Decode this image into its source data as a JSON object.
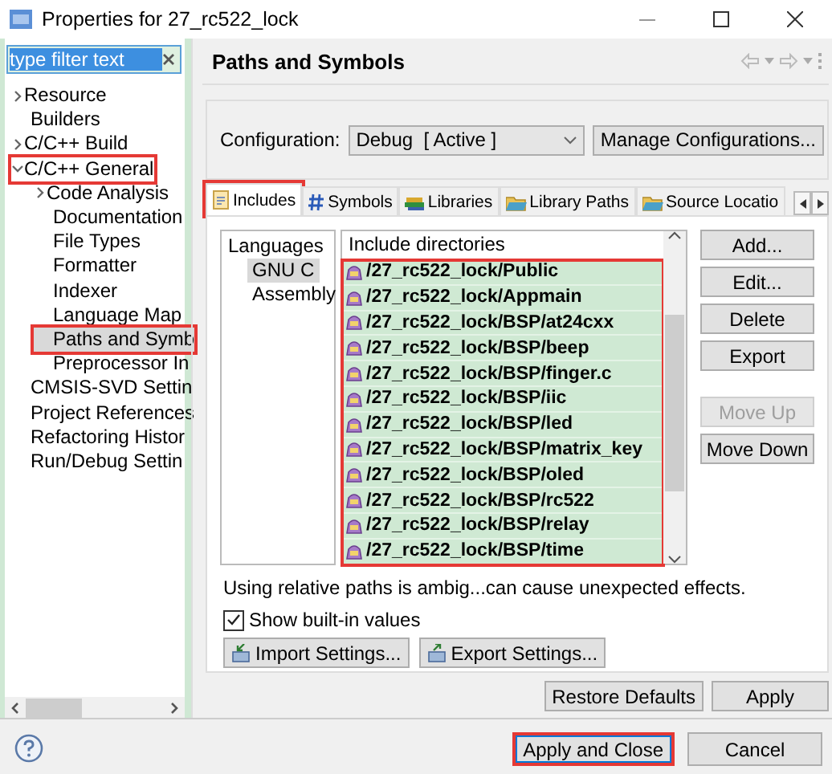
{
  "window": {
    "title": "Properties for 27_rc522_lock"
  },
  "sidebar": {
    "filter": {
      "value": "type filter text"
    },
    "tree": [
      {
        "label": "Resource",
        "expanded": false,
        "selected": false,
        "highlighted": false
      },
      {
        "label": "Builders",
        "selected": false,
        "highlighted": false
      },
      {
        "label": "C/C++ Build",
        "expanded": false,
        "selected": false,
        "highlighted": false
      },
      {
        "label": "C/C++ General",
        "expanded": true,
        "selected": false,
        "highlighted": true,
        "children": [
          {
            "label": "Code Analysis",
            "expanded": false,
            "selected": false,
            "highlighted": false
          },
          {
            "label": "Documentation",
            "selected": false,
            "highlighted": false
          },
          {
            "label": "File Types",
            "selected": false,
            "highlighted": false
          },
          {
            "label": "Formatter",
            "selected": false,
            "highlighted": false
          },
          {
            "label": "Indexer",
            "selected": false,
            "highlighted": false
          },
          {
            "label": "Language Map",
            "selected": false,
            "highlighted": false
          },
          {
            "label": "Paths and Symb",
            "selected": true,
            "highlighted": true
          },
          {
            "label": "Preprocessor In",
            "selected": false,
            "highlighted": false
          }
        ]
      },
      {
        "label": "CMSIS-SVD Settin",
        "selected": false,
        "highlighted": false
      },
      {
        "label": "Project References",
        "selected": false,
        "highlighted": false
      },
      {
        "label": "Refactoring Histor",
        "selected": false,
        "highlighted": false
      },
      {
        "label": "Run/Debug Settin",
        "selected": false,
        "highlighted": false
      }
    ]
  },
  "page": {
    "title": "Paths and Symbols"
  },
  "configuration": {
    "label": "Configuration:",
    "value": "Debug  [ Active ]",
    "button": "Manage Configurations..."
  },
  "tabs": [
    {
      "label": "Includes",
      "kind": "document",
      "selected": true,
      "highlighted": true
    },
    {
      "label": "Symbols",
      "kind": "hash",
      "selected": false,
      "highlighted": false
    },
    {
      "label": "Libraries",
      "kind": "books",
      "selected": false,
      "highlighted": false
    },
    {
      "label": "Library Paths",
      "kind": "folder",
      "selected": false,
      "highlighted": false
    },
    {
      "label": "Source Locatio",
      "kind": "folder",
      "selected": false,
      "highlighted": false
    }
  ],
  "languages": {
    "title": "Languages",
    "items": [
      {
        "label": "GNU C",
        "selected": true
      },
      {
        "label": "Assembly",
        "selected": false
      }
    ]
  },
  "include_table": {
    "column": "Include directories",
    "highlighted": true,
    "rows": [
      "/27_rc522_lock/Public",
      "/27_rc522_lock/Appmain",
      "/27_rc522_lock/BSP/at24cxx",
      "/27_rc522_lock/BSP/beep",
      "/27_rc522_lock/BSP/finger.c",
      "/27_rc522_lock/BSP/iic",
      "/27_rc522_lock/BSP/led",
      "/27_rc522_lock/BSP/matrix_key",
      "/27_rc522_lock/BSP/oled",
      "/27_rc522_lock/BSP/rc522",
      "/27_rc522_lock/BSP/relay",
      "/27_rc522_lock/BSP/time"
    ]
  },
  "side_buttons": [
    {
      "label": "Add...",
      "disabled": false
    },
    {
      "label": "Edit...",
      "disabled": false
    },
    {
      "label": "Delete",
      "disabled": false
    },
    {
      "label": "Export",
      "disabled": false
    },
    {
      "label": "Move Up",
      "disabled": true
    },
    {
      "label": "Move Down",
      "disabled": false
    }
  ],
  "note": "Using relative paths is ambig...can cause unexpected effects.",
  "show_builtin": {
    "label": "Show built-in values",
    "checked": true
  },
  "settings_buttons": [
    {
      "label": "Import Settings...",
      "kind": "import"
    },
    {
      "label": "Export Settings...",
      "kind": "export"
    }
  ],
  "page_buttons": [
    "Restore Defaults",
    "Apply"
  ],
  "dialog_buttons": [
    {
      "label": "Apply and Close",
      "highlighted": true,
      "default": true
    },
    {
      "label": "Cancel",
      "highlighted": false,
      "default": false
    }
  ]
}
